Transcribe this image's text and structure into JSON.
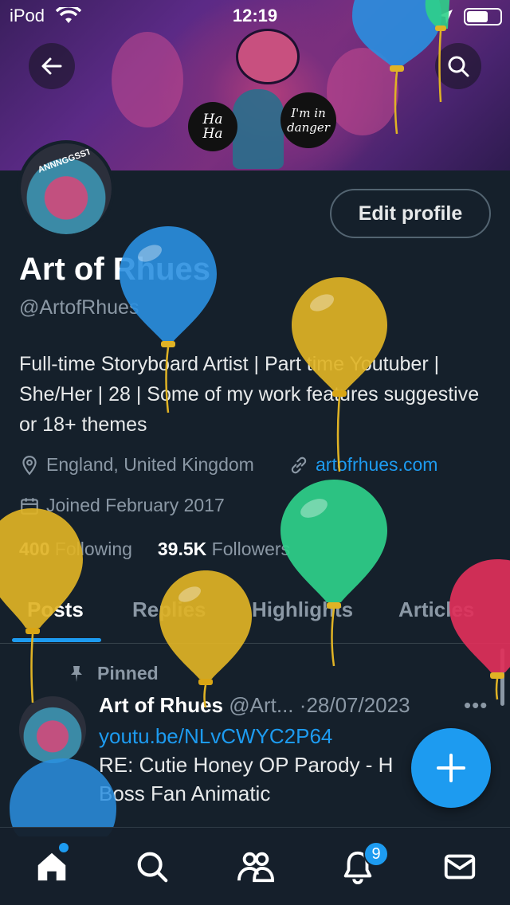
{
  "status_bar": {
    "carrier": "iPod",
    "time": "12:19"
  },
  "banner": {
    "bubble_left": "Ha\nHa",
    "bubble_right": "I'm in danger",
    "avatar_text": "ANNNGGSST"
  },
  "profile": {
    "display_name": "Art of Rhues",
    "handle": "@ArtofRhues",
    "edit_label": "Edit profile",
    "bio": "Full-time Storyboard Artist | Part time Youtuber | She/Her | 28 | Some of my work features suggestive or 18+ themes",
    "location": "England, United Kingdom",
    "website": "artofrhues.com",
    "joined": "Joined February 2017",
    "following_count": "400",
    "following_label": "Following",
    "followers_count": "39.5K",
    "followers_label": "Followers"
  },
  "tabs": [
    "Posts",
    "Replies",
    "Highlights",
    "Articles"
  ],
  "active_tab": "Posts",
  "pinned_tweet": {
    "pinned_label": "Pinned",
    "author": "Art of Rhues",
    "handle": "@Art...",
    "separator": "·",
    "date": "28/07/2023",
    "more": "•••",
    "link": "youtu.be/NLvCWYC2P64",
    "text": "RE: Cutie Honey OP Parody - H Boss Fan Animatic"
  },
  "fab_label": "+",
  "nav": {
    "items": [
      "home-icon",
      "search-icon",
      "communities-icon",
      "notifications-icon",
      "messages-icon"
    ],
    "notification_badge": "9"
  },
  "colors": {
    "background": "#15202b",
    "accent": "#1d9bf0",
    "muted": "#8b98a5",
    "balloon_blue": "#2a8fe0",
    "balloon_yellow": "#e0b325",
    "balloon_green": "#2fd08a",
    "balloon_red": "#e0305a"
  }
}
